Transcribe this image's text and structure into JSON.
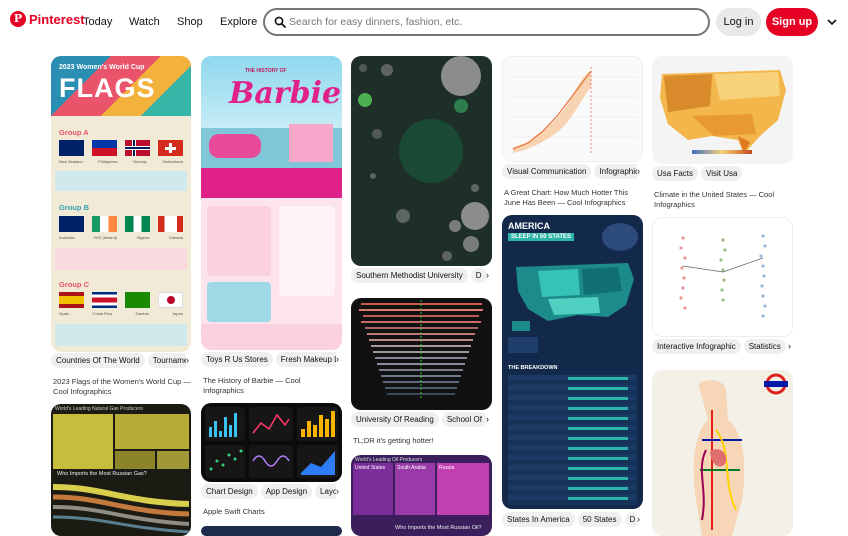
{
  "header": {
    "logo": "Pinterest",
    "nav": [
      "Today",
      "Watch",
      "Shop",
      "Explore"
    ],
    "search_placeholder": "Search for easy dinners, fashion, etc.",
    "login": "Log in",
    "signup": "Sign up"
  },
  "pins": {
    "flags": {
      "title": "2023 Women's World Cup",
      "big": "FLAGS",
      "groupA": "Group A",
      "countriesA": [
        "New Zealand",
        "Philippines",
        "Norway",
        "Switzerland"
      ],
      "groupB": "Group B",
      "countriesB": [
        "Australia",
        "ROI (Ireland)",
        "Nigeria",
        "Canada"
      ],
      "groupC": "Group C",
      "countriesC": [
        "Spain",
        "Costa Rica",
        "Zambia",
        "Japan"
      ],
      "tags": [
        "Countries Of The World",
        "Tournament"
      ],
      "caption": "2023 Flags of the Women's World Cup — Cool Infographics"
    },
    "barbie": {
      "small": "THE HISTORY OF",
      "big": "Barbie",
      "tags": [
        "Toys R Us Stores",
        "Fresh Makeup L"
      ],
      "caption": "The History of Barbie — Cool Infographics"
    },
    "bubbles": {
      "tags": [
        "Southern Methodist University",
        "D"
      ]
    },
    "tldr": {
      "tags": [
        "University Of Reading",
        "School Of"
      ],
      "caption": "TL;DR it's getting hotter!"
    },
    "hotter": {
      "tags": [
        "Visual Communication",
        "Infographic"
      ],
      "caption": "A Great Chart: How Much Hotter This June Has Been — Cool Infographics"
    },
    "america": {
      "title": "AMERICA",
      "sub": "SLEEP IN 50 STATES",
      "breakdown": "THE BREAKDOWN",
      "tags": [
        "States In America",
        "50 States",
        "D"
      ]
    },
    "usa": {
      "tags": [
        "Usa Facts",
        "Visit Usa"
      ],
      "caption": "Climate in the United States — Cool Infographics"
    },
    "interactive": {
      "tags": [
        "Interactive Infographic",
        "Statistics"
      ]
    },
    "gas": {
      "heading": "World's Leading Natural Gas Producers",
      "sub": "Who Imports the Most Russian Gas?"
    },
    "swift": {
      "tags": [
        "Chart Design",
        "App Design",
        "Layo"
      ],
      "caption": "Apple Swift Charts"
    },
    "oil": {
      "heading": "World's Leading Oil Producers",
      "labels": [
        "United States",
        "South Arabia",
        "Russia"
      ],
      "sub": "Who Imports the Most Russian Oil?"
    }
  }
}
